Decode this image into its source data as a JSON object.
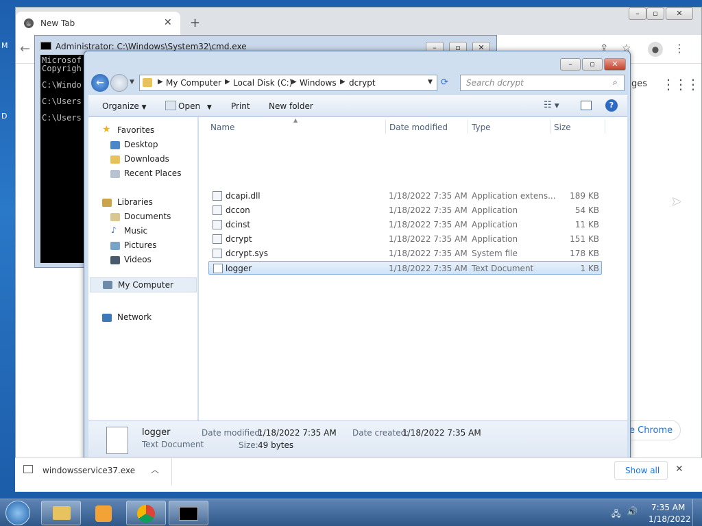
{
  "desktop": {
    "label_m": "M",
    "label_d": "D"
  },
  "chrome": {
    "tab_title": "New Tab",
    "new_tab_symbol": "+",
    "partial_ges": "ges",
    "partial_chrome_btn": "e Chrome",
    "icons": [
      "chrome-logo-icon",
      "close-icon",
      "back-icon",
      "share-icon",
      "star-icon",
      "profile-icon",
      "kebab-menu-icon",
      "apps-grid-icon"
    ]
  },
  "cmd": {
    "title": "Administrator: C:\\Windows\\System32\\cmd.exe",
    "lines": [
      "Microsof",
      "Copyrigh",
      "",
      "C:\\Windo",
      "",
      "C:\\Users",
      "",
      "C:\\Users"
    ]
  },
  "explorer": {
    "breadcrumb": [
      "My Computer",
      "Local Disk (C:)",
      "Windows",
      "dcrypt"
    ],
    "search_placeholder": "Search dcrypt",
    "toolbar": {
      "organize": "Organize",
      "open": "Open",
      "print": "Print",
      "new_folder": "New folder"
    },
    "nav": {
      "favorites": "Favorites",
      "favorites_items": [
        "Desktop",
        "Downloads",
        "Recent Places"
      ],
      "libraries": "Libraries",
      "libraries_items": [
        "Documents",
        "Music",
        "Pictures",
        "Videos"
      ],
      "my_computer": "My Computer",
      "network": "Network"
    },
    "columns": {
      "name": "Name",
      "date": "Date modified",
      "type": "Type",
      "size": "Size"
    },
    "files": [
      {
        "name": "dcapi.dll",
        "date": "1/18/2022 7:35 AM",
        "type": "Application extens...",
        "size": "189 KB"
      },
      {
        "name": "dccon",
        "date": "1/18/2022 7:35 AM",
        "type": "Application",
        "size": "54 KB"
      },
      {
        "name": "dcinst",
        "date": "1/18/2022 7:35 AM",
        "type": "Application",
        "size": "11 KB"
      },
      {
        "name": "dcrypt",
        "date": "1/18/2022 7:35 AM",
        "type": "Application",
        "size": "151 KB"
      },
      {
        "name": "dcrypt.sys",
        "date": "1/18/2022 7:35 AM",
        "type": "System file",
        "size": "178 KB"
      },
      {
        "name": "logger",
        "date": "1/18/2022 7:35 AM",
        "type": "Text Document",
        "size": "1 KB"
      }
    ],
    "details": {
      "name": "logger",
      "type": "Text Document",
      "date_modified_label": "Date modified:",
      "date_modified": "1/18/2022 7:35 AM",
      "date_created_label": "Date created:",
      "date_created": "1/18/2022 7:35 AM",
      "size_label": "Size:",
      "size": "49 bytes"
    }
  },
  "download_bar": {
    "file": "windowsservice37.exe",
    "show_all": "Show all"
  },
  "taskbar": {
    "time": "7:35 AM",
    "date": "1/18/2022"
  },
  "colors": {
    "accent": "#3c7ddc",
    "selection": "#cfe3f9"
  }
}
